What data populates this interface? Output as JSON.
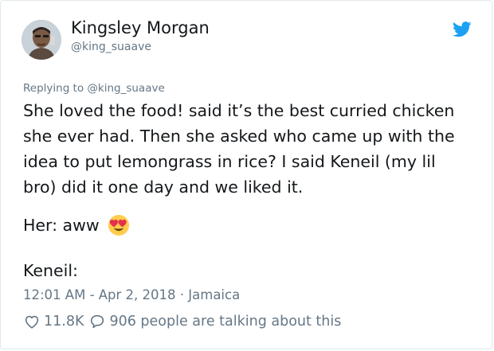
{
  "user": {
    "name": "Kingsley Morgan",
    "handle": "@king_suaave"
  },
  "icons": {
    "brand": "twitter-bird-icon",
    "like": "heart-outline-icon",
    "reply": "speech-bubble-icon",
    "reaction": "heart-eyes-emoji"
  },
  "colors": {
    "brand_blue": "#1da1f2",
    "muted_gray": "#657786",
    "text": "#14171a"
  },
  "tweet": {
    "replying_to": "Replying to @king_suaave",
    "lines": [
      "She loved the food! said it’s the best curried chicken",
      "she ever had. Then she asked who came up with the",
      "idea to put lemongrass in rice? I said Keneil (my lil",
      "bro) did it one day and we liked it."
    ],
    "her_line": "Her: aww",
    "keneil_line": "Keneil:",
    "meta": "12:01 AM - Apr 2, 2018 · Jamaica"
  },
  "stats": {
    "likes": "11.8K",
    "talking": "906 people are talking about this"
  }
}
